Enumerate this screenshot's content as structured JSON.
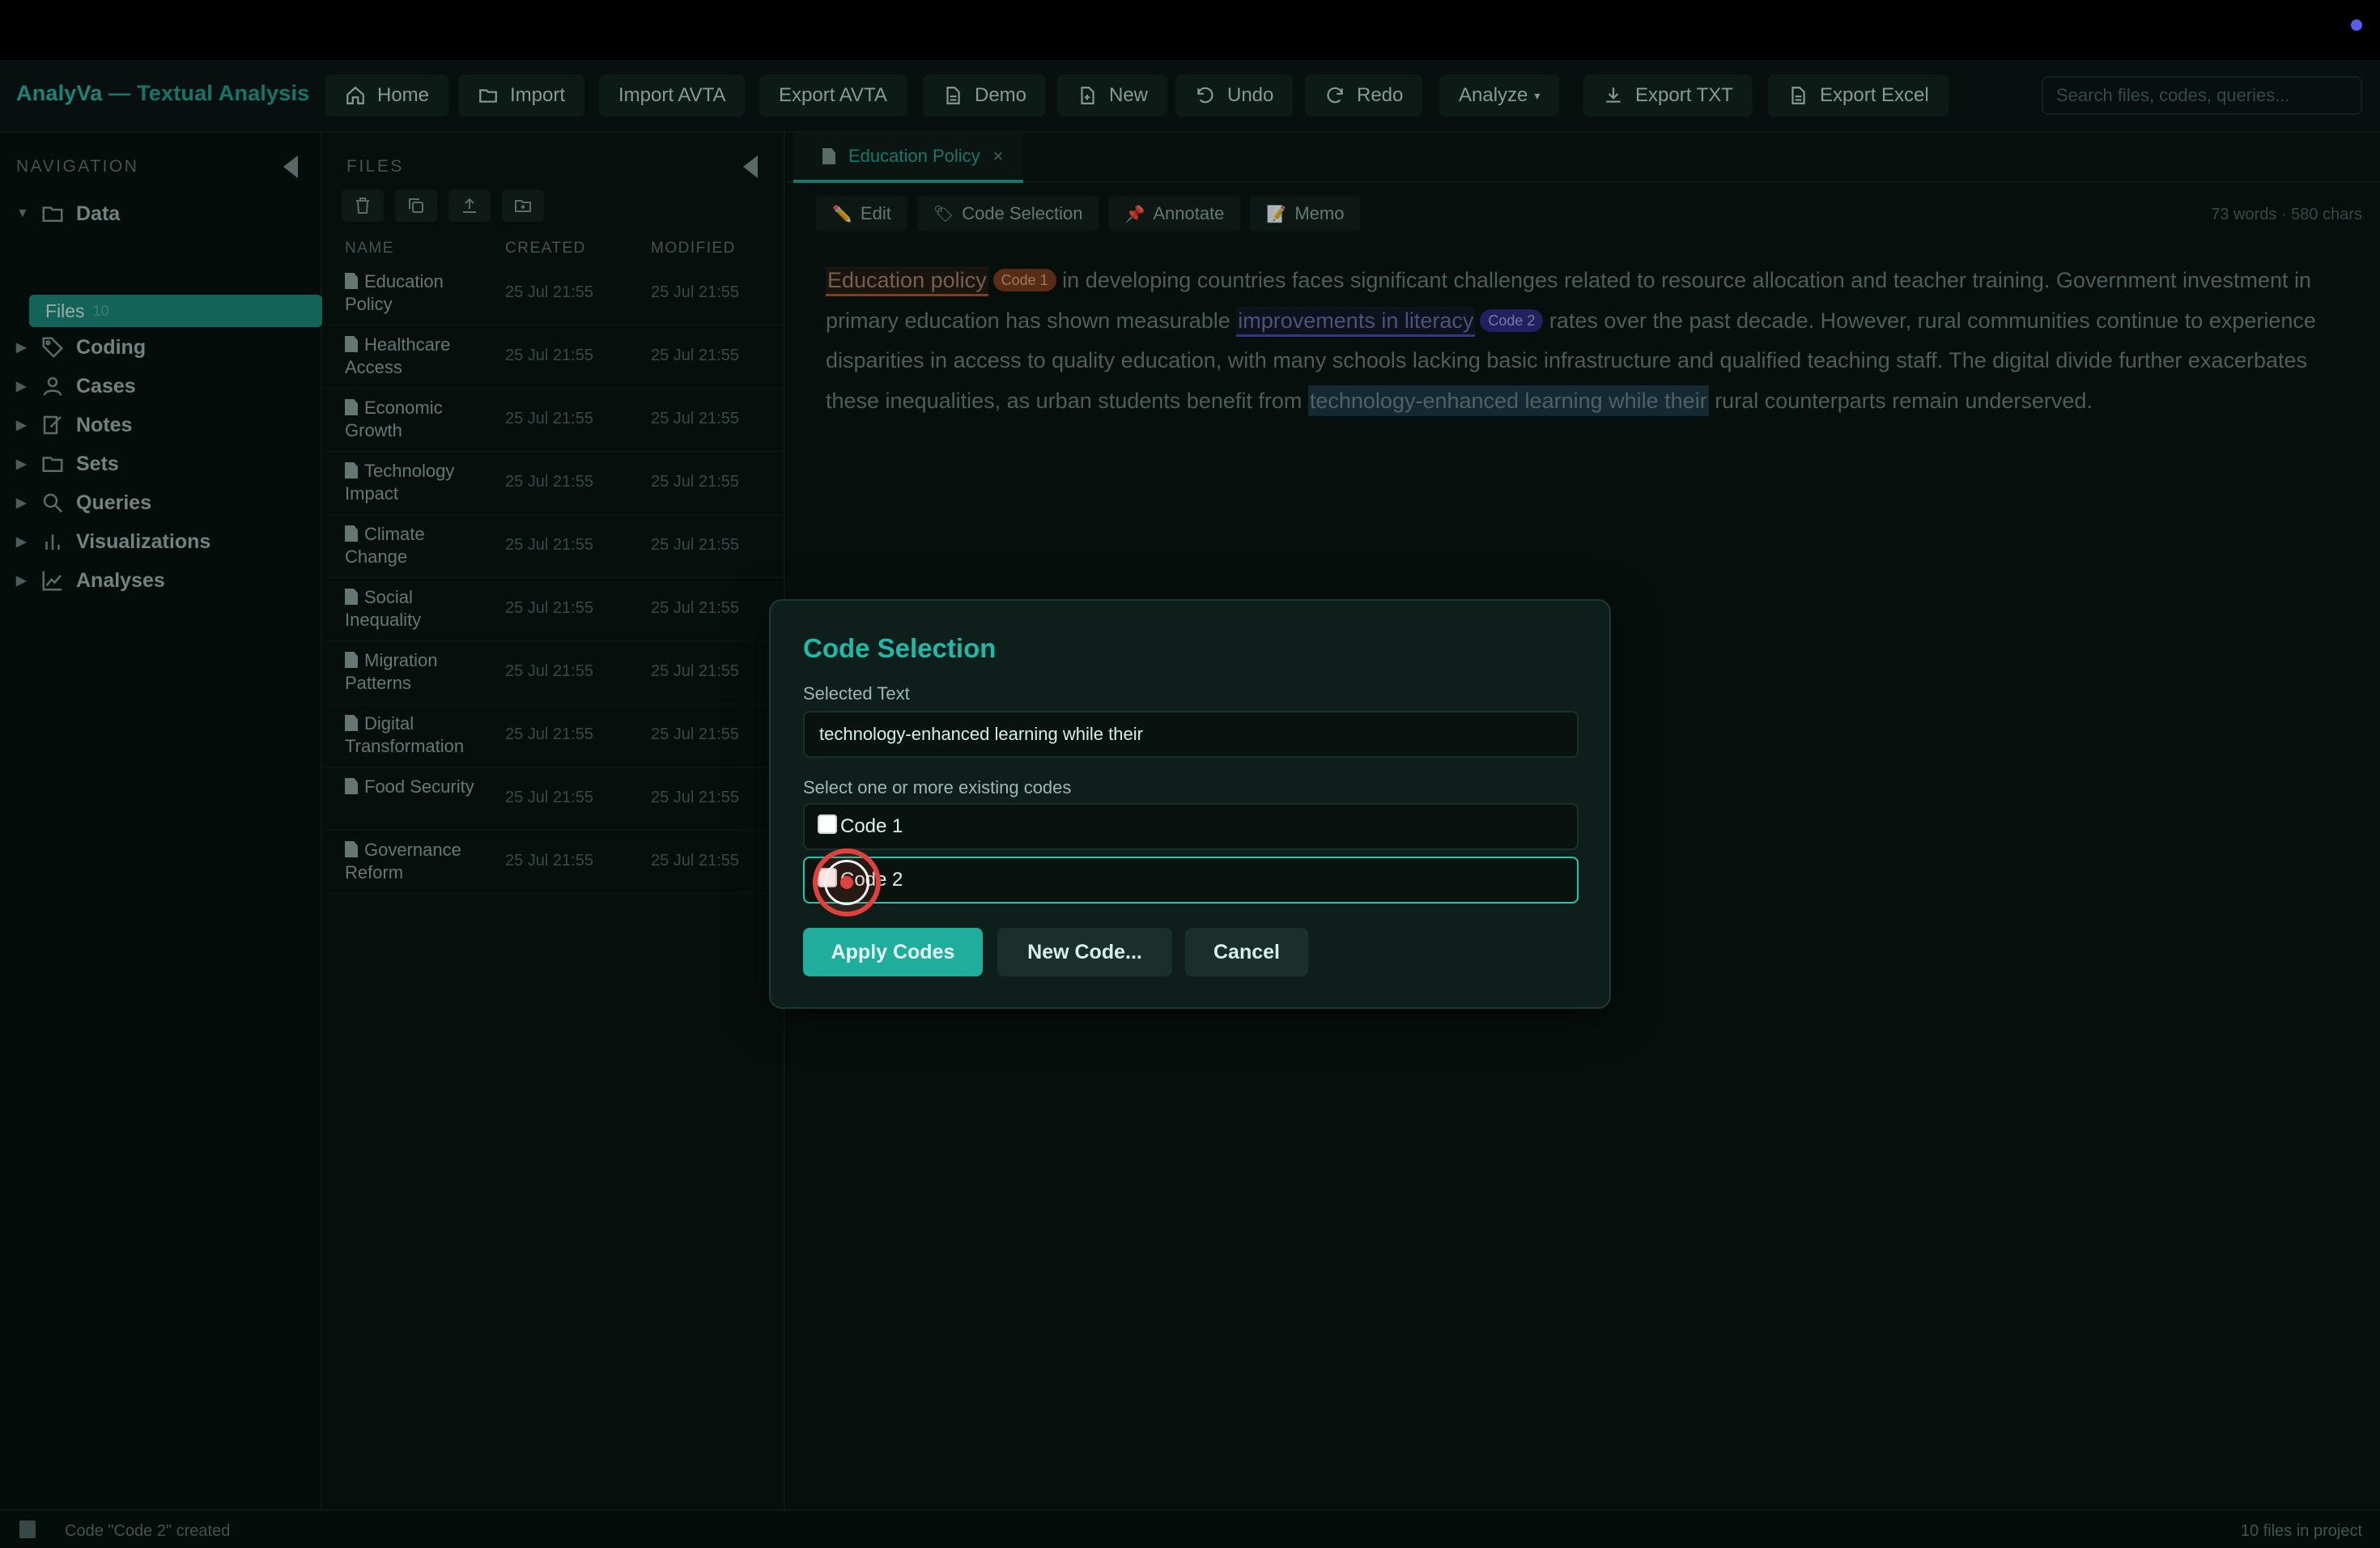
{
  "app": {
    "brand_part1": "AnalyVa",
    "brand_part2": " — Textual Analysis"
  },
  "toolbar": {
    "home": "Home",
    "import": "Import",
    "import_avta": "Import AVTA",
    "export_avta": "Export AVTA",
    "demo": "Demo",
    "new": "New",
    "undo": "Undo",
    "redo": "Redo",
    "analyze": "Analyze",
    "export_txt": "Export TXT",
    "export_excel": "Export Excel",
    "search_placeholder": "Search files, codes, queries..."
  },
  "navigation": {
    "title": "NAVIGATION",
    "items": [
      {
        "label": "Data",
        "icon": "folder-icon",
        "expanded": true
      },
      {
        "label": "Coding",
        "icon": "tag-icon"
      },
      {
        "label": "Cases",
        "icon": "person-icon"
      },
      {
        "label": "Notes",
        "icon": "note-icon"
      },
      {
        "label": "Sets",
        "icon": "folder-icon"
      },
      {
        "label": "Queries",
        "icon": "search-icon"
      },
      {
        "label": "Visualizations",
        "icon": "bar-chart-icon"
      },
      {
        "label": "Analyses",
        "icon": "line-chart-icon"
      }
    ],
    "files_label": "Files",
    "files_count": "10"
  },
  "files": {
    "title": "FILES",
    "columns": [
      "NAME",
      "CREATED",
      "MODIFIED"
    ],
    "rows": [
      {
        "name": "Education Policy",
        "created": "25 Jul 21:55",
        "modified": "25 Jul 21:55"
      },
      {
        "name": "Healthcare Access",
        "created": "25 Jul 21:55",
        "modified": "25 Jul 21:55"
      },
      {
        "name": "Economic Growth",
        "created": "25 Jul 21:55",
        "modified": "25 Jul 21:55"
      },
      {
        "name": "Technology Impact",
        "created": "25 Jul 21:55",
        "modified": "25 Jul 21:55"
      },
      {
        "name": "Climate Change",
        "created": "25 Jul 21:55",
        "modified": "25 Jul 21:55"
      },
      {
        "name": "Social Inequality",
        "created": "25 Jul 21:55",
        "modified": "25 Jul 21:55"
      },
      {
        "name": "Migration Patterns",
        "created": "25 Jul 21:55",
        "modified": "25 Jul 21:55"
      },
      {
        "name": "Digital Transformation",
        "created": "25 Jul 21:55",
        "modified": "25 Jul 21:55"
      },
      {
        "name": "Food Security",
        "created": "25 Jul 21:55",
        "modified": "25 Jul 21:55"
      },
      {
        "name": "Governance Reform",
        "created": "25 Jul 21:55",
        "modified": "25 Jul 21:55"
      }
    ]
  },
  "document": {
    "tab_label": "Education Policy",
    "tab_close": "×",
    "tools": {
      "edit": "Edit",
      "code_selection": "Code Selection",
      "annotate": "Annotate",
      "memo": "Memo"
    },
    "word_count": "73 words · 580 chars",
    "text": {
      "hl1": "Education policy",
      "badge1": "Code 1",
      "p1": " in developing countries faces significant challenges related to resource allocation and teacher training. Government investment in primary education has shown measurable ",
      "hl2": "improvements in literacy",
      "badge2": "Code 2",
      "p2": " rates over the past decade. However, rural communities continue to experience disparities in access to quality education, with many schools lacking basic infrastructure and qualified teaching staff. The digital divide further exacerbates these inequalities, as urban students benefit from ",
      "selected": "technology-enhanced learning while their",
      "p3": " rural counterparts remain underserved."
    }
  },
  "modal": {
    "title": "Code Selection",
    "selected_label": "Selected Text",
    "selected_value": "technology-enhanced learning while their",
    "codes_label": "Select one or more existing codes",
    "codes": [
      "Code 1",
      "Code 2"
    ],
    "apply": "Apply Codes",
    "new_code": "New Code...",
    "cancel": "Cancel"
  },
  "status": {
    "message": "Code \"Code 2\" created",
    "right": "10 files in project"
  }
}
